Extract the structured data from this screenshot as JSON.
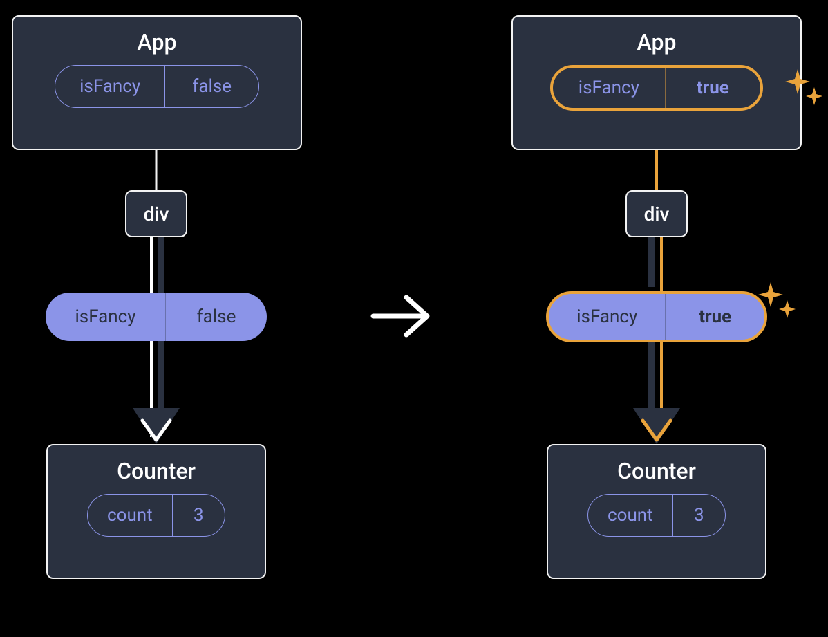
{
  "left": {
    "app": {
      "title": "App",
      "state": {
        "key": "isFancy",
        "value": "false"
      }
    },
    "div": {
      "label": "div"
    },
    "prop": {
      "key": "isFancy",
      "value": "false"
    },
    "counter": {
      "title": "Counter",
      "state": {
        "key": "count",
        "value": "3"
      }
    }
  },
  "right": {
    "app": {
      "title": "App",
      "state": {
        "key": "isFancy",
        "value": "true"
      }
    },
    "div": {
      "label": "div"
    },
    "prop": {
      "key": "isFancy",
      "value": "true"
    },
    "counter": {
      "title": "Counter",
      "state": {
        "key": "count",
        "value": "3"
      }
    }
  },
  "colors": {
    "bg": "#000000",
    "card": "#2a3140",
    "border": "#f3f3f3",
    "purple": "#8b94e8",
    "orange": "#e9a33b"
  }
}
